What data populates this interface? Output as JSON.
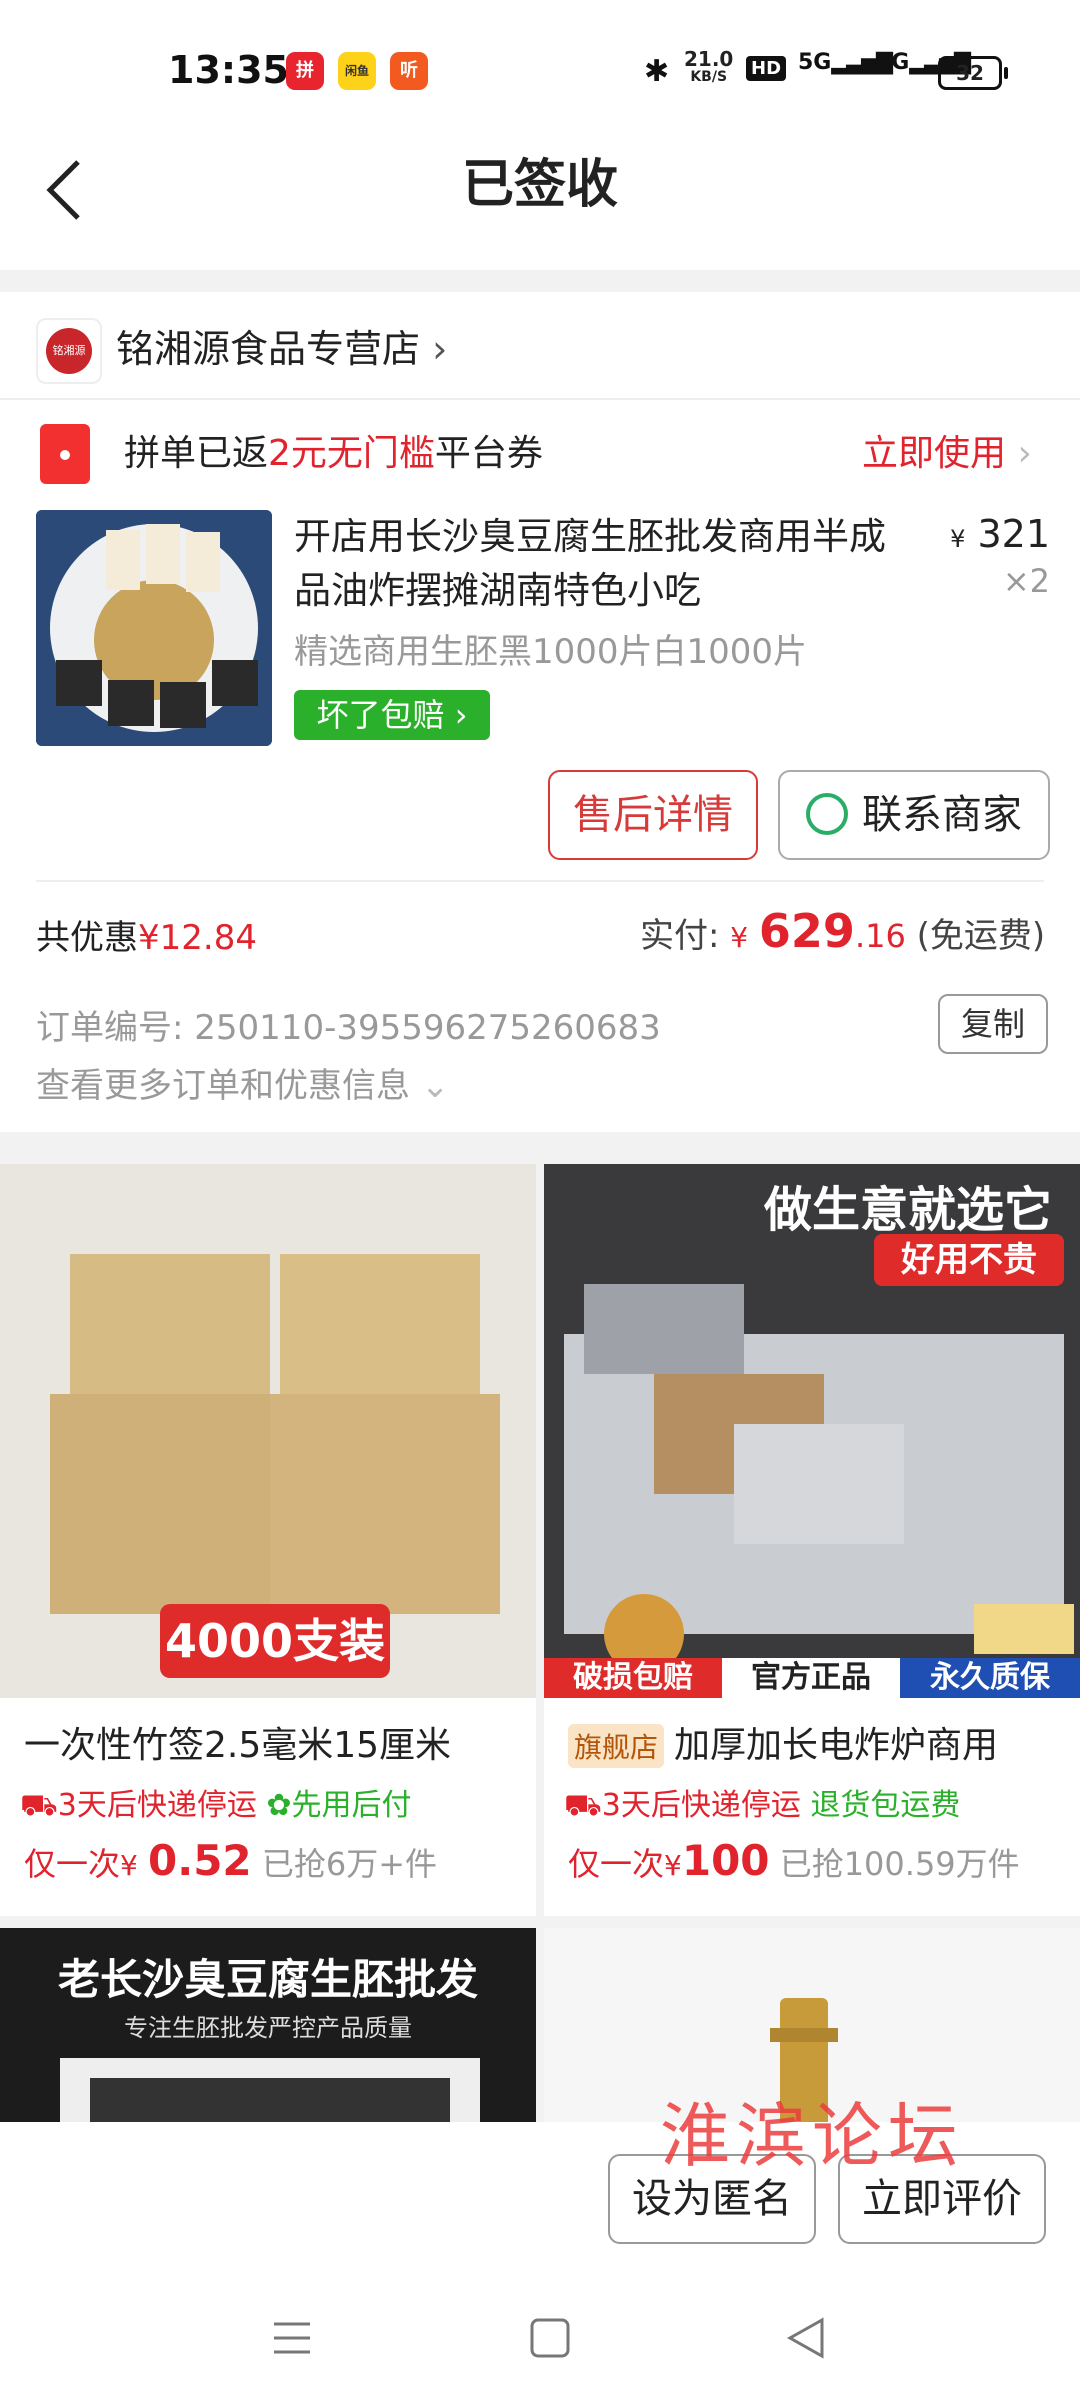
{
  "status_bar": {
    "time": "13:35",
    "app_icons": [
      "拼",
      "闲鱼",
      "听"
    ],
    "net_speed_top": "21.0",
    "net_speed_unit": "KB/S",
    "hd": "HD",
    "signal1": "5G",
    "signal2": "5G",
    "battery": "32"
  },
  "header": {
    "title": "已签收"
  },
  "shop": {
    "name": "铭湘源食品专营店",
    "logo_text": "铭湘源"
  },
  "coupon": {
    "prefix": "拼单已返",
    "highlight": "2元无门槛",
    "suffix": "平台券",
    "action": "立即使用"
  },
  "product": {
    "title": "开店用长沙臭豆腐生胚批发商用半成品油炸摆摊湖南特色小吃",
    "spec": "精选商用生胚黑1000片白1000片",
    "badge": "坏了包赔",
    "currency": "¥",
    "price": "321",
    "qty": "×2"
  },
  "actions": {
    "after_sale": "售后详情",
    "contact": "联系商家"
  },
  "summary": {
    "discount_label": "共优惠",
    "discount_value": "¥12.84",
    "paid_label": "实付: ",
    "paid_currency": "¥",
    "paid_int": "629",
    "paid_dec": ".16",
    "shipping": "(免运费)"
  },
  "order": {
    "number_label": "订单编号:",
    "number": "250110-395596275260683",
    "copy": "复制",
    "more": "查看更多订单和优惠信息"
  },
  "feed": [
    {
      "img_caption": "4000支装",
      "title": "一次性竹签2.5毫米15厘米",
      "tag1": "3天后快递停运",
      "tag2": "先用后付",
      "price_prefix": "仅一次",
      "currency": "¥",
      "price": "0.52",
      "sold": "已抢6万+件"
    },
    {
      "img_top": "做生意就选它",
      "img_badge": "好用不贵",
      "img_strip1": "破损包赔",
      "img_strip2": "官方正品",
      "img_strip3": "永久质保",
      "flag": "旗舰店",
      "title": "加厚加长电炸炉商用",
      "tag1": "3天后快递停运",
      "tag2": "退货包运费",
      "price_prefix": "仅一次",
      "currency": "¥",
      "price": "100",
      "sold": "已抢100.59万件"
    },
    {
      "img_title": "老长沙臭豆腐生胚批发",
      "img_sub": "专注生胚批发严控产品质量"
    }
  ],
  "bottom": {
    "anonymous": "设为匿名",
    "review": "立即评价"
  },
  "watermark": "淮滨论坛",
  "colors": {
    "accent": "#e0232c",
    "green": "#2ab02a"
  }
}
